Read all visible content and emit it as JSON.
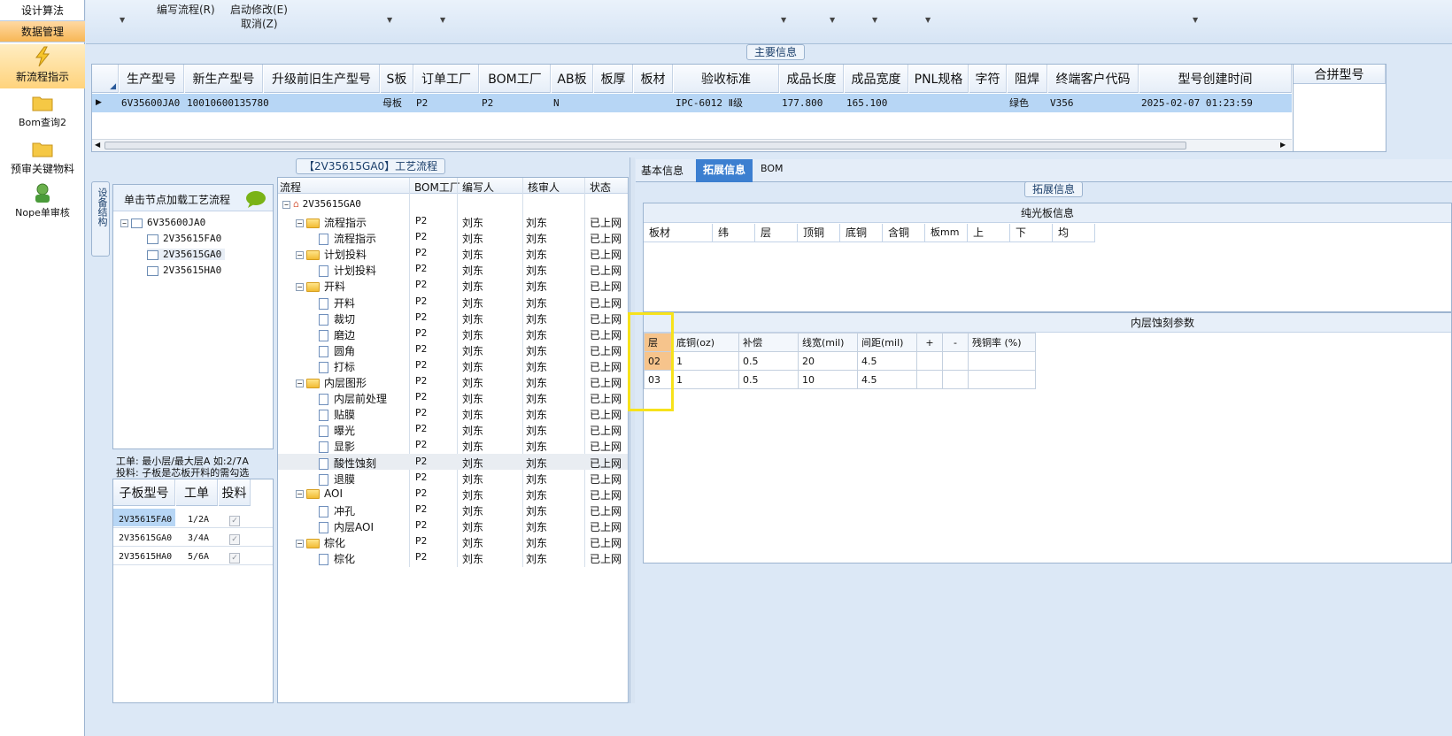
{
  "nav": {
    "top_items": [
      "设计算法",
      "数据管理"
    ],
    "buttons": [
      {
        "label": "新流程指示",
        "icon": "lightning-icon"
      },
      {
        "label": "Bom查询2",
        "icon": "folder-icon"
      },
      {
        "label": "预审关键物料",
        "icon": "folder-icon"
      },
      {
        "label": "Nope单审核",
        "icon": "user-icon"
      }
    ]
  },
  "toolbar": {
    "edit_flow": "编写流程(R)",
    "start_modify": "启动修改(E)",
    "cancel": "取消(Z)"
  },
  "main_info": {
    "caption": "主要信息",
    "columns": [
      "生产型号",
      "新生产型号",
      "升级前旧生产型号",
      "S板",
      "订单工厂",
      "BOM工厂",
      "AB板",
      "板厚",
      "板材",
      "验收标准",
      "成品长度",
      "成品宽度",
      "PNL规格",
      "字符",
      "阻焊",
      "终端客户代码",
      "型号创建时间"
    ],
    "row": [
      "6V35600JA0",
      "10010600135780",
      "",
      "母板",
      "P2",
      "P2",
      "N",
      "",
      "",
      "IPC-6012 Ⅱ级",
      "177.800",
      "165.100",
      "",
      "",
      "绿色",
      "V356",
      "2025-02-07 01:23:59"
    ],
    "merge_col": "合拼型号"
  },
  "process": {
    "caption": "【2V35615GA0】工艺流程",
    "side_tab": "设备结构",
    "hint": "单击节点加载工艺流程",
    "tree": [
      "6V35600JA0",
      "2V35615FA0",
      "2V35615GA0",
      "2V35615HA0"
    ],
    "note1": "工单: 最小层/最大层A 如:2/7A",
    "note2": "投料: 子板是芯板开料的需勾选",
    "sub_table": {
      "headers": [
        "子板型号",
        "工单",
        "投料"
      ],
      "rows": [
        [
          "2V35615FA0",
          "1/2A",
          "✓"
        ],
        [
          "2V35615GA0",
          "3/4A",
          "✓"
        ],
        [
          "2V35615HA0",
          "5/6A",
          "✓"
        ]
      ]
    },
    "flow_headers": [
      "流程",
      "BOM工厂",
      "编写人",
      "核审人",
      "状态"
    ],
    "flow_root": "2V35615GA0",
    "flow_rows": [
      {
        "name": "流程指示",
        "level": 1,
        "f": "P2",
        "w": "刘东",
        "r": "刘东",
        "s": "已上网"
      },
      {
        "name": "流程指示",
        "level": 2,
        "f": "P2",
        "w": "刘东",
        "r": "刘东",
        "s": "已上网"
      },
      {
        "name": "计划投料",
        "level": 1,
        "f": "P2",
        "w": "刘东",
        "r": "刘东",
        "s": "已上网"
      },
      {
        "name": "计划投料",
        "level": 2,
        "f": "P2",
        "w": "刘东",
        "r": "刘东",
        "s": "已上网"
      },
      {
        "name": "开料",
        "level": 1,
        "f": "P2",
        "w": "刘东",
        "r": "刘东",
        "s": "已上网"
      },
      {
        "name": "开料",
        "level": 2,
        "f": "P2",
        "w": "刘东",
        "r": "刘东",
        "s": "已上网"
      },
      {
        "name": "裁切",
        "level": 2,
        "f": "P2",
        "w": "刘东",
        "r": "刘东",
        "s": "已上网"
      },
      {
        "name": "磨边",
        "level": 2,
        "f": "P2",
        "w": "刘东",
        "r": "刘东",
        "s": "已上网"
      },
      {
        "name": "圆角",
        "level": 2,
        "f": "P2",
        "w": "刘东",
        "r": "刘东",
        "s": "已上网"
      },
      {
        "name": "打标",
        "level": 2,
        "f": "P2",
        "w": "刘东",
        "r": "刘东",
        "s": "已上网"
      },
      {
        "name": "内层图形",
        "level": 1,
        "f": "P2",
        "w": "刘东",
        "r": "刘东",
        "s": "已上网"
      },
      {
        "name": "内层前处理",
        "level": 2,
        "f": "P2",
        "w": "刘东",
        "r": "刘东",
        "s": "已上网"
      },
      {
        "name": "贴膜",
        "level": 2,
        "f": "P2",
        "w": "刘东",
        "r": "刘东",
        "s": "已上网"
      },
      {
        "name": "曝光",
        "level": 2,
        "f": "P2",
        "w": "刘东",
        "r": "刘东",
        "s": "已上网"
      },
      {
        "name": "显影",
        "level": 2,
        "f": "P2",
        "w": "刘东",
        "r": "刘东",
        "s": "已上网"
      },
      {
        "name": "酸性蚀刻",
        "level": 2,
        "f": "P2",
        "w": "刘东",
        "r": "刘东",
        "s": "已上网"
      },
      {
        "name": "退膜",
        "level": 2,
        "f": "P2",
        "w": "刘东",
        "r": "刘东",
        "s": "已上网"
      },
      {
        "name": "AOI",
        "level": 1,
        "f": "P2",
        "w": "刘东",
        "r": "刘东",
        "s": "已上网"
      },
      {
        "name": "冲孔",
        "level": 2,
        "f": "P2",
        "w": "刘东",
        "r": "刘东",
        "s": "已上网"
      },
      {
        "name": "内层AOI",
        "level": 2,
        "f": "P2",
        "w": "刘东",
        "r": "刘东",
        "s": "已上网"
      },
      {
        "name": "棕化",
        "level": 1,
        "f": "P2",
        "w": "刘东",
        "r": "刘东",
        "s": "已上网"
      },
      {
        "name": "棕化",
        "level": 2,
        "f": "P2",
        "w": "刘东",
        "r": "刘东",
        "s": "已上网"
      }
    ]
  },
  "right": {
    "tabs": [
      "基本信息",
      "拓展信息",
      "BOM"
    ],
    "caption": "拓展信息",
    "bare_title": "纯光板信息",
    "bare_headers": [
      "板材",
      "纬",
      "层",
      "顶铜",
      "底铜",
      "含铜",
      "板mm",
      "上",
      "下",
      "均"
    ],
    "etch_title": "内层蚀刻参数",
    "etch_headers": [
      "层",
      "底铜(oz)",
      "补偿",
      "线宽(mil)",
      "间距(mil)",
      "+",
      "-",
      "残铜率 (%)"
    ],
    "etch_rows": [
      [
        "02",
        "1",
        "0.5",
        "20",
        "4.5",
        "",
        "",
        ""
      ],
      [
        "03",
        "1",
        "0.5",
        "10",
        "4.5",
        "",
        "",
        ""
      ]
    ]
  },
  "colors": {
    "selected": "#b7d6f5",
    "highlight": "#f7e21b",
    "accent_tab": "#3c7fd0"
  }
}
